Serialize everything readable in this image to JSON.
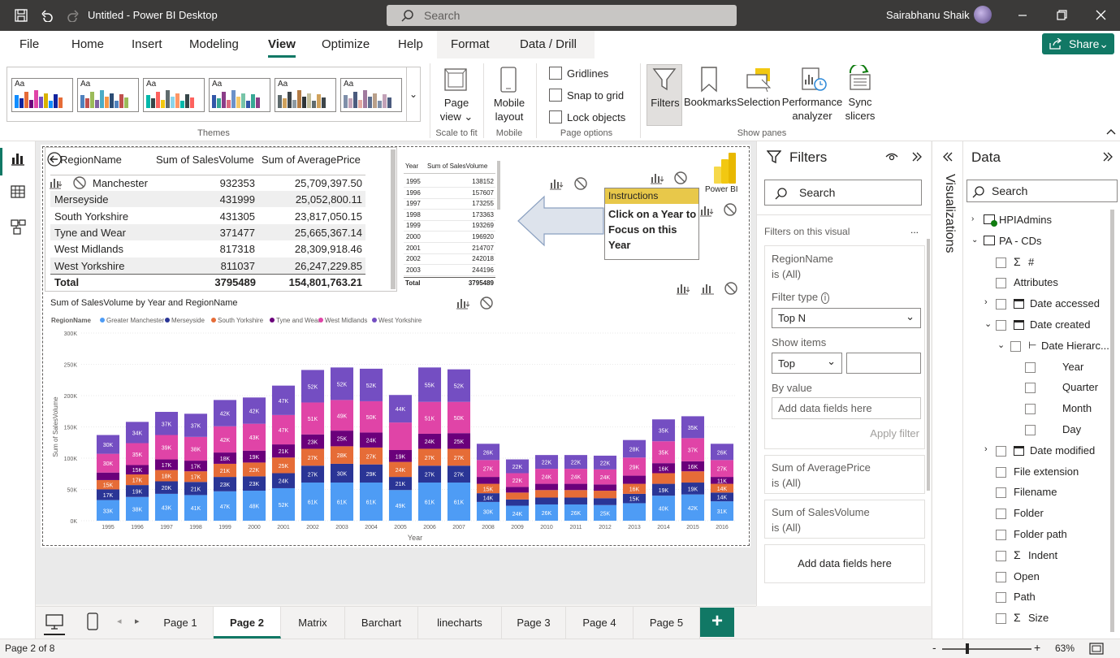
{
  "titlebar": {
    "title": "Untitled - Power BI Desktop",
    "search": "Search",
    "user": "Sairabhanu Shaik"
  },
  "menu": {
    "items": [
      "File",
      "Home",
      "Insert",
      "Modeling",
      "View",
      "Optimize",
      "Help",
      "Format",
      "Data / Drill"
    ],
    "active": "View",
    "share": "Share"
  },
  "ribbon": {
    "themes_label": "Themes",
    "theme_aa": "Aa",
    "page_view": "Page",
    "page_view2": "view",
    "scale_label": "Scale to fit",
    "mobile": "Mobile",
    "mobile2": "layout",
    "mobile_label": "Mobile",
    "gridlines": "Gridlines",
    "snap": "Snap to grid",
    "lock": "Lock objects",
    "page_options_label": "Page options",
    "filters": "Filters",
    "bookmarks": "Bookmarks",
    "selection": "Selection",
    "perf": "Performance",
    "perf2": "analyzer",
    "sync": "Sync",
    "sync2": "slicers",
    "show_panes_label": "Show panes"
  },
  "table": {
    "headers": [
      "RegionName",
      "Sum of SalesVolume",
      "Sum of AveragePrice"
    ],
    "rows": [
      [
        "Manchester",
        "932353",
        "25,709,397.50"
      ],
      [
        "Merseyside",
        "431999",
        "25,052,800.11"
      ],
      [
        "South Yorkshire",
        "431305",
        "23,817,050.15"
      ],
      [
        "Tyne and Wear",
        "371477",
        "25,665,367.14"
      ],
      [
        "West Midlands",
        "817318",
        "28,309,918.46"
      ],
      [
        "West Yorkshire",
        "811037",
        "26,247,229.85"
      ]
    ],
    "total": [
      "Total",
      "3795489",
      "154,801,763.21"
    ]
  },
  "smalltable": {
    "headers": [
      "Year",
      "Sum of SalesVolume"
    ],
    "rows": [
      [
        "1995",
        "138152"
      ],
      [
        "1996",
        "157607"
      ],
      [
        "1997",
        "173255"
      ],
      [
        "1998",
        "173363"
      ],
      [
        "1999",
        "193269"
      ],
      [
        "2000",
        "196920"
      ],
      [
        "2001",
        "214707"
      ],
      [
        "2002",
        "242018"
      ],
      [
        "2003",
        "244196"
      ]
    ],
    "total": [
      "Total",
      "3795489"
    ]
  },
  "instructions": {
    "header": "Instructions",
    "body": "Click on a Year to Focus on this Year"
  },
  "powerbi_logo": "Power BI",
  "chart_data": {
    "type": "bar",
    "stacked": true,
    "title": "Sum of SalesVolume by Year and RegionName",
    "legend_title": "RegionName",
    "xlabel": "Year",
    "ylabel": "Sum of SalesVolume",
    "yticks": [
      "0K",
      "50K",
      "100K",
      "150K",
      "200K",
      "250K",
      "300K"
    ],
    "ylim": [
      0,
      300000
    ],
    "legend_position": "top-left",
    "categories": [
      "1995",
      "1996",
      "1997",
      "1998",
      "1999",
      "2000",
      "2001",
      "2002",
      "2003",
      "2004",
      "2005",
      "2006",
      "2007",
      "2008",
      "2009",
      "2010",
      "2011",
      "2012",
      "2013",
      "2014",
      "2015",
      "2016"
    ],
    "series": [
      {
        "name": "Greater Manchester",
        "color": "#4e9cf5",
        "values": [
          33000,
          38000,
          43000,
          41000,
          47000,
          48000,
          52000,
          61000,
          61000,
          61000,
          49000,
          61000,
          61000,
          30000,
          24000,
          26000,
          26000,
          25000,
          28000,
          40000,
          42000,
          31000
        ],
        "labels": [
          "33K",
          "38K",
          "43K",
          "41K",
          "47K",
          "48K",
          "52K",
          "61K",
          "61K",
          "61K",
          "49K",
          "61K",
          "61K",
          "30K",
          "24K",
          "26K",
          "26K",
          "25K",
          "",
          "40K",
          "42K",
          "31K"
        ]
      },
      {
        "name": "Merseyside",
        "color": "#2a3596",
        "values": [
          17000,
          19000,
          20000,
          21000,
          23000,
          23000,
          24000,
          27000,
          30000,
          29000,
          21000,
          27000,
          27000,
          14000,
          10000,
          11000,
          11000,
          11000,
          15000,
          19000,
          19000,
          14000
        ],
        "labels": [
          "17K",
          "19K",
          "20K",
          "21K",
          "23K",
          "23K",
          "24K",
          "27K",
          "30K",
          "29K",
          "21K",
          "27K",
          "27K",
          "14K",
          "",
          "",
          "",
          "",
          "15K",
          "19K",
          "19K",
          "14K"
        ]
      },
      {
        "name": "South Yorkshire",
        "color": "#e66c37",
        "values": [
          15000,
          17000,
          18000,
          17000,
          21000,
          22000,
          25000,
          27000,
          28000,
          27000,
          24000,
          27000,
          27000,
          15000,
          11000,
          12000,
          12000,
          12000,
          16000,
          17000,
          18000,
          14000
        ],
        "labels": [
          "15K",
          "17K",
          "18K",
          "17K",
          "21K",
          "22K",
          "25K",
          "27K",
          "28K",
          "27K",
          "24K",
          "27K",
          "27K",
          "15K",
          "",
          "",
          "",
          "",
          "16K",
          "",
          "",
          "14K"
        ]
      },
      {
        "name": "Tyne and Wear",
        "color": "#6b007b",
        "values": [
          12000,
          15000,
          17000,
          17000,
          18000,
          19000,
          21000,
          23000,
          25000,
          24000,
          19000,
          24000,
          25000,
          11000,
          9000,
          10000,
          10000,
          10000,
          13000,
          16000,
          16000,
          11000
        ],
        "labels": [
          "",
          "15K",
          "17K",
          "17K",
          "18K",
          "19K",
          "21K",
          "23K",
          "25K",
          "24K",
          "19K",
          "24K",
          "25K",
          "",
          "",
          "",
          "",
          "",
          "",
          "16K",
          "16K",
          "11K"
        ]
      },
      {
        "name": "West Midlands",
        "color": "#e044a7",
        "values": [
          30000,
          35000,
          39000,
          38000,
          42000,
          43000,
          47000,
          51000,
          49000,
          50000,
          44000,
          51000,
          50000,
          27000,
          22000,
          24000,
          24000,
          24000,
          29000,
          35000,
          37000,
          27000
        ],
        "labels": [
          "30K",
          "35K",
          "39K",
          "38K",
          "42K",
          "43K",
          "47K",
          "51K",
          "49K",
          "50K",
          "",
          "51K",
          "50K",
          "27K",
          "22K",
          "24K",
          "24K",
          "24K",
          "29K",
          "35K",
          "37K",
          "27K"
        ]
      },
      {
        "name": "West Yorkshire",
        "color": "#744ec2",
        "values": [
          30000,
          34000,
          37000,
          37000,
          42000,
          42000,
          47000,
          52000,
          52000,
          52000,
          44000,
          55000,
          52000,
          26000,
          22000,
          22000,
          22000,
          22000,
          28000,
          35000,
          35000,
          26000
        ],
        "labels": [
          "30K",
          "34K",
          "37K",
          "37K",
          "42K",
          "42K",
          "47K",
          "52K",
          "52K",
          "52K",
          "44K",
          "55K",
          "52K",
          "26K",
          "22K",
          "22K",
          "22K",
          "22K",
          "28K",
          "35K",
          "35K",
          "26K"
        ]
      }
    ]
  },
  "filters": {
    "title": "Filters",
    "search": "Search",
    "on_visual": "Filters on this visual",
    "more": "...",
    "region": "RegionName",
    "region_val": "is (All)",
    "filter_type_label": "Filter type",
    "filter_type": "Top N",
    "show_items": "Show items",
    "top": "Top",
    "by_value": "By value",
    "add_fields": "Add data fields here",
    "apply": "Apply filter",
    "avg": "Sum of AveragePrice",
    "avg_val": "is (All)",
    "sales": "Sum of SalesVolume",
    "sales_val": "is (All)",
    "add_fields2": "Add data fields here"
  },
  "viz": {
    "label": "Visualizations"
  },
  "data": {
    "title": "Data",
    "search": "Search",
    "items": [
      {
        "label": "HPIAdmins",
        "level": 0
      },
      {
        "label": "PA - CDs",
        "level": 0
      },
      {
        "label": "#",
        "level": 1
      },
      {
        "label": "Attributes",
        "level": 1
      },
      {
        "label": "Date accessed",
        "level": 1
      },
      {
        "label": "Date created",
        "level": 1
      },
      {
        "label": "Date Hierarc...",
        "level": 2
      },
      {
        "label": "Year",
        "level": 3
      },
      {
        "label": "Quarter",
        "level": 3
      },
      {
        "label": "Month",
        "level": 3
      },
      {
        "label": "Day",
        "level": 3
      },
      {
        "label": "Date modified",
        "level": 1
      },
      {
        "label": "File extension",
        "level": 1
      },
      {
        "label": "Filename",
        "level": 1
      },
      {
        "label": "Folder",
        "level": 1
      },
      {
        "label": "Folder path",
        "level": 1
      },
      {
        "label": "Indent",
        "level": 1
      },
      {
        "label": "Open",
        "level": 1
      },
      {
        "label": "Path",
        "level": 1
      },
      {
        "label": "Size",
        "level": 1
      }
    ]
  },
  "tabs": {
    "items": [
      "Page 1",
      "Page 2",
      "Matrix",
      "Barchart",
      "linecharts",
      "Page 3",
      "Page 4",
      "Page 5"
    ],
    "active": "Page 2",
    "add": "+"
  },
  "status": {
    "page": "Page 2 of 8",
    "zoom": "63%",
    "zoom_minus": "-",
    "zoom_plus": "+"
  }
}
